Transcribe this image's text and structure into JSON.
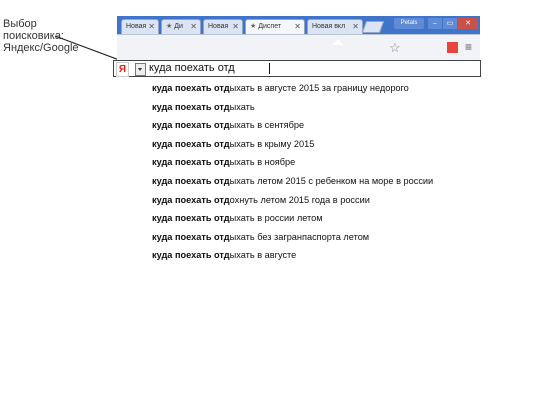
{
  "annotation": {
    "lines": [
      "Выбор",
      "поисковика:",
      "Яндекс/Google"
    ]
  },
  "browser": {
    "tabs": [
      {
        "label": "Новая",
        "active": false
      },
      {
        "label": "Ди",
        "active": false
      },
      {
        "label": "Новая",
        "active": false
      },
      {
        "label": "Диспет",
        "active": true
      },
      {
        "label": "Новая вкл",
        "active": false
      }
    ],
    "profile_label": "Petals"
  },
  "search": {
    "engine_icon": "Я",
    "query": "куда поехать отд"
  },
  "suggestions": [
    {
      "prefix": "куда поехать отд",
      "rest": "ыхать в августе 2015 за границу недорого"
    },
    {
      "prefix": "куда поехать отд",
      "rest": "ыхать"
    },
    {
      "prefix": "куда поехать отд",
      "rest": "ыхать в сентябре"
    },
    {
      "prefix": "куда поехать отд",
      "rest": "ыхать в крыму 2015"
    },
    {
      "prefix": "куда поехать отд",
      "rest": "ыхать в ноябре"
    },
    {
      "prefix": "куда поехать отд",
      "rest": "ыхать летом 2015 с ребенком на море в россии"
    },
    {
      "prefix": "куда поехать отд",
      "rest": "охнуть летом 2015 года в россии"
    },
    {
      "prefix": "куда поехать отд",
      "rest": "ыхать в россии летом"
    },
    {
      "prefix": "куда поехать отд",
      "rest": "ыхать без загранпаспорта летом"
    },
    {
      "prefix": "куда поехать отд",
      "rest": "ыхать в августе"
    }
  ]
}
